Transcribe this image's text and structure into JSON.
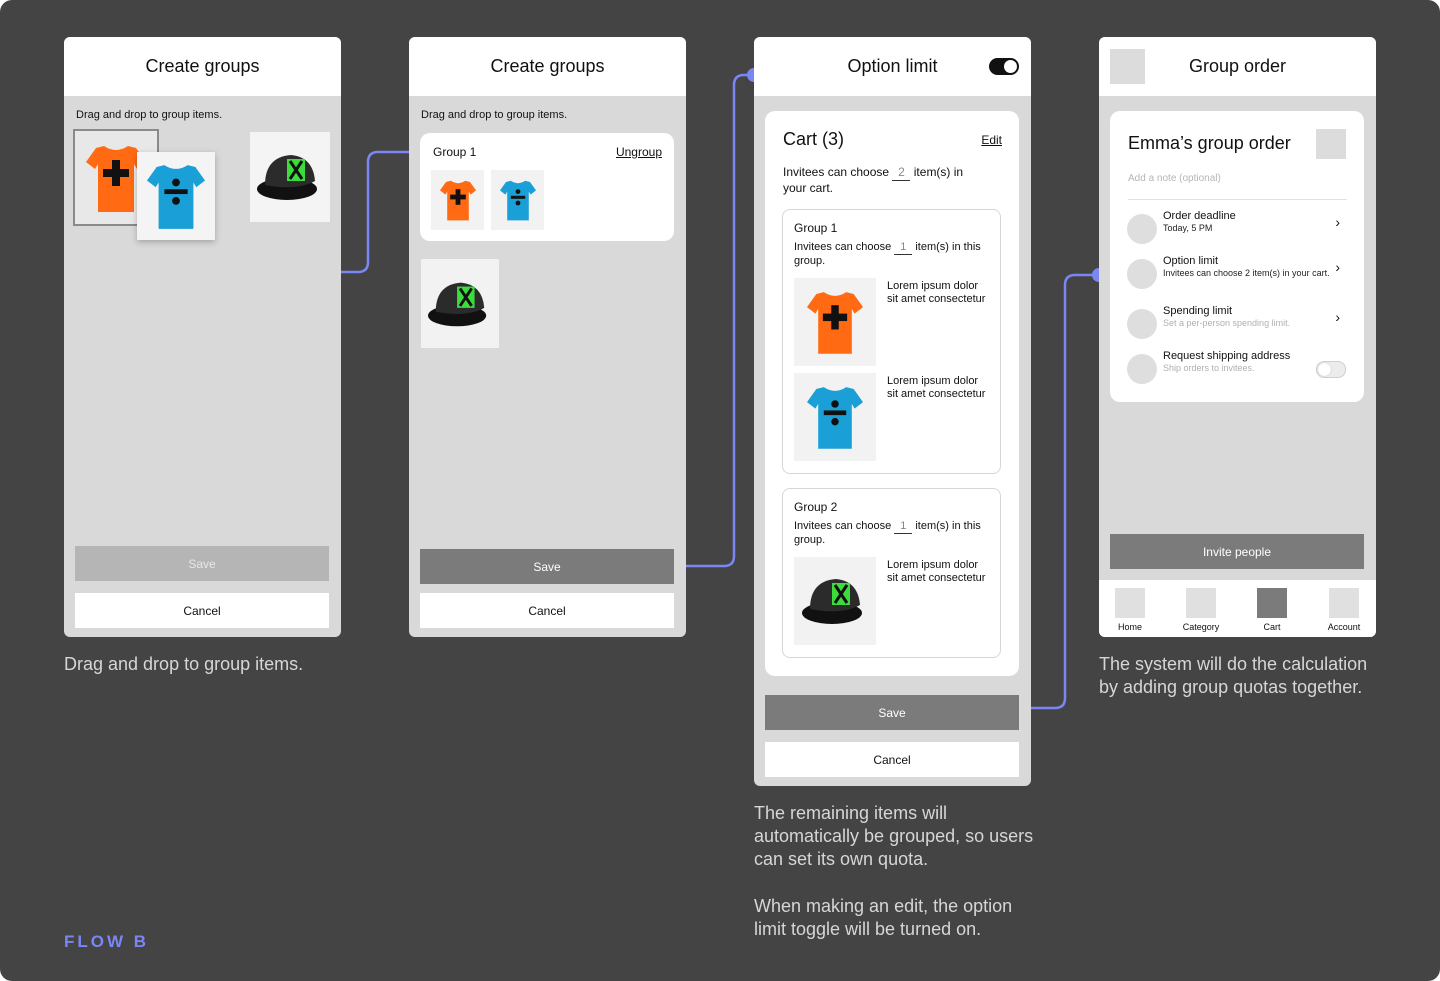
{
  "colors": {
    "board": "#444444",
    "connector": "#7b86f5",
    "phone_bg": "#d9d9d9",
    "save_button": "#7b7b7b",
    "tee_orange": "#ff6a13",
    "tee_blue": "#1a9fd6",
    "cap_green": "#3ddc3d"
  },
  "screen1": {
    "title": "Create groups",
    "hint": "Drag and drop to group items.",
    "save_label": "Save",
    "cancel_label": "Cancel",
    "caption": "Drag and drop to group items."
  },
  "screen2": {
    "title": "Create groups",
    "hint": "Drag and drop to group items.",
    "group_label": "Group 1",
    "ungroup_label": "Ungroup",
    "save_label": "Save",
    "cancel_label": "Cancel"
  },
  "screen3": {
    "title": "Option limit",
    "toggle_on": true,
    "cart_title": "Cart (3)",
    "edit_label": "Edit",
    "cart_pre": "Invitees can choose",
    "cart_qty": "2",
    "cart_post": "item(s) in",
    "cart_post2": "your cart.",
    "groups": [
      {
        "name": "Group 1",
        "pre": "Invitees can choose",
        "qty": "1",
        "post": "item(s) in this",
        "post2": "group.",
        "items": [
          {
            "icon": "orange-tshirt-plus",
            "text": "Lorem ipsum dolor sit amet consectetur"
          },
          {
            "icon": "blue-tshirt-divide",
            "text": "Lorem ipsum dolor sit amet consectetur"
          }
        ]
      },
      {
        "name": "Group 2",
        "pre": "Invitees can choose",
        "qty": "1",
        "post": "item(s) in this",
        "post2": "group.",
        "items": [
          {
            "icon": "black-cap-x",
            "text": "Lorem ipsum dolor sit amet consectetur"
          }
        ]
      }
    ],
    "save_label": "Save",
    "cancel_label": "Cancel",
    "caption_1": "The remaining items will automatically be grouped, so users can set its own quota.",
    "caption_2": "When making an edit, the option limit toggle will be turned on."
  },
  "screen4": {
    "title": "Group order",
    "order_title": "Emma’s group order",
    "note_placeholder": "Add a note (optional)",
    "rows": [
      {
        "title": "Order deadline",
        "subtitle": "Today, 5 PM",
        "control": "chevron"
      },
      {
        "title": "Option limit",
        "subtitle": "Invitees can choose  2 item(s) in your cart.",
        "control": "chevron"
      },
      {
        "title": "Spending limit",
        "subtitle": "Set a per-person spending limit.",
        "control": "chevron"
      },
      {
        "title": "Request shipping address",
        "subtitle": "Ship orders to invitees.",
        "control": "toggle-off"
      }
    ],
    "invite_label": "Invite people",
    "tabs": [
      {
        "label": "Home",
        "active": false
      },
      {
        "label": "Category",
        "active": false
      },
      {
        "label": "Cart",
        "active": true
      },
      {
        "label": "Account",
        "active": false
      }
    ],
    "caption": "The system will do the calculation by adding group quotas together."
  },
  "flow_label": "FLOW B"
}
